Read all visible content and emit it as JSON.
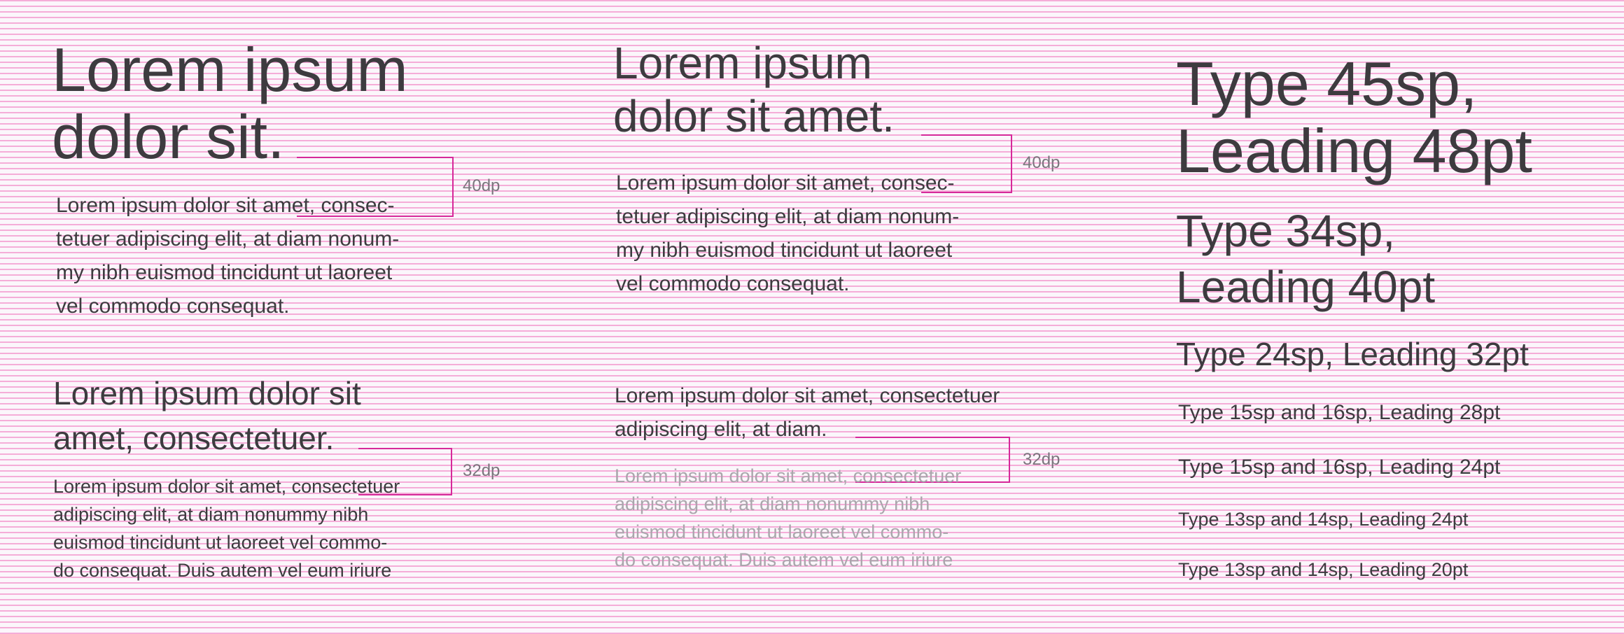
{
  "col1": {
    "heading_large": [
      "Lorem ipsum",
      "dolor sit."
    ],
    "body_a": [
      "Lorem ipsum dolor sit amet, consec-",
      "tetuer adipiscing elit, at diam nonum-",
      "my nibh euismod tincidunt ut laoreet",
      "vel commodo consequat."
    ],
    "spacing_a": "40dp",
    "heading_medium": [
      "Lorem ipsum dolor sit",
      "amet, consectetuer."
    ],
    "body_b": [
      "Lorem ipsum dolor sit amet, consectetuer",
      "adipiscing elit, at diam nonummy nibh",
      "euismod tincidunt ut laoreet vel commo-",
      "do consequat. Duis autem vel eum iriure"
    ],
    "spacing_b": "32dp"
  },
  "col2": {
    "heading_large": [
      "Lorem ipsum",
      "dolor sit amet."
    ],
    "body_a": [
      "Lorem ipsum dolor sit amet, consec-",
      "tetuer adipiscing elit, at diam nonum-",
      "my nibh euismod tincidunt ut laoreet",
      "vel commodo consequat."
    ],
    "spacing_a": "40dp",
    "heading_medium": [
      "Lorem ipsum dolor sit amet, consectetuer",
      "adipiscing elit, at diam."
    ],
    "body_b": [
      "Lorem ipsum dolor sit amet, consectetuer",
      "adipiscing elit, at diam nonummy nibh",
      "euismod tincidunt ut laoreet vel commo-",
      "do consequat. Duis autem vel eum iriure"
    ],
    "spacing_b": "32dp"
  },
  "col3": {
    "type45": [
      "Type 45sp,",
      "Leading 48pt"
    ],
    "type34": [
      "Type 34sp,",
      "Leading 40pt"
    ],
    "type24": "Type 24sp, Leading 32pt",
    "type16_28": "Type 15sp and 16sp, Leading 28pt",
    "type16_24": "Type 15sp and 16sp, Leading 24pt",
    "type14_24": "Type 13sp and 14sp, Leading 24pt",
    "type14_20": "Type 13sp and 14sp, Leading 20pt"
  },
  "colors": {
    "text": "#3d3b3f",
    "muted_text": "#aaa6ac",
    "baseline_grid": "#ec48a8",
    "bracket": "#d6299a",
    "label": "#7b757d"
  }
}
